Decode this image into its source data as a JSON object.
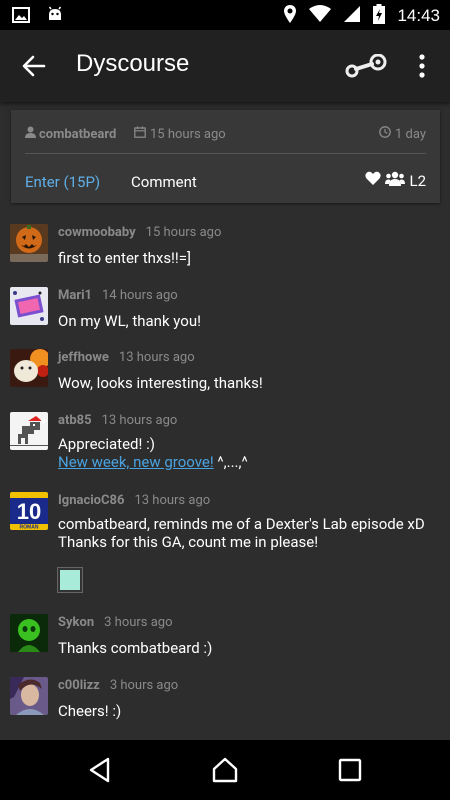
{
  "status": {
    "time": "14:43"
  },
  "appbar": {
    "title": "Dyscourse"
  },
  "giveaway": {
    "author": "combatbeard",
    "created": "15 hours ago",
    "remaining": "1 day",
    "enter_label": "Enter (15P)",
    "comment_label": "Comment",
    "level": "L2"
  },
  "comments": [
    {
      "user": "cowmoobaby",
      "time": "15 hours ago",
      "text": "first to enter thxs!!=]"
    },
    {
      "user": "Mari1",
      "time": "14 hours ago",
      "text": "On my WL, thank you!"
    },
    {
      "user": "jeffhowe",
      "time": "13 hours ago",
      "text": "Wow, looks interesting, thanks!"
    },
    {
      "user": "atb85",
      "time": "13 hours ago",
      "text": "Appreciated! :)",
      "link": "New week, new groove!",
      "tail": " ^,...,^"
    },
    {
      "user": "IgnacioC86",
      "time": "13 hours ago",
      "text": "combatbeard, reminds me of a Dexter's Lab episode xD",
      "text2": "Thanks for this GA, count me in please!"
    },
    {
      "user": "Sykon",
      "time": "3 hours ago",
      "text": "Thanks combatbeard :)"
    },
    {
      "user": "c00lizz",
      "time": "3 hours ago",
      "text": "Cheers! :)"
    }
  ],
  "colors": {
    "accent": "#5fb0e8",
    "link": "#4aa3e0",
    "background": "#2d2d2d",
    "card": "#383838",
    "muted": "#8a8a8a"
  }
}
